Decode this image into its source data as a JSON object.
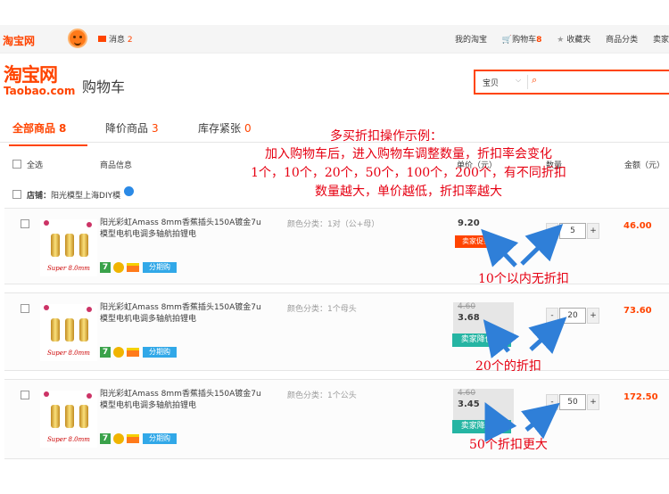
{
  "topbar": {
    "logo": "淘宝网",
    "messages_label": "消息",
    "messages_count": "2",
    "nav": {
      "my_taobao": "我的淘宝",
      "cart_label": "购物车",
      "cart_count": "8",
      "favorites": "收藏夹",
      "categories": "商品分类",
      "more": "卖家"
    }
  },
  "header": {
    "logo_cn": "淘宝网",
    "logo_en": "Taobao.com",
    "title": "购物车",
    "search_category": "宝贝"
  },
  "tabs": [
    {
      "label": "全部商品",
      "count": "8"
    },
    {
      "label": "降价商品",
      "count": "3"
    },
    {
      "label": "库存紧张",
      "count": "0"
    }
  ],
  "columns": {
    "select_all": "全选",
    "product_info": "商品信息",
    "price": "单价（元）",
    "qty": "数量",
    "amount": "金额（元）"
  },
  "shop": {
    "label": "店铺：",
    "name": "阳光模型上海DIY模"
  },
  "items": [
    {
      "title": "阳光彩虹Amass 8mm香蕉插头150A镀金7u模型电机电调多轴航拍锂电",
      "sku": "颜色分类：1对（公+母）",
      "old_price": "",
      "price": "9.20",
      "tag": "卖家促销",
      "qty": "5",
      "amount": "46.00",
      "thumb_brand": "Super 8.0mm",
      "pay_badge": "分期购",
      "badge_7": "7"
    },
    {
      "title": "阳光彩虹Amass 8mm香蕉插头150A镀金7u模型电机电调多轴航拍锂电",
      "sku": "颜色分类：1个母头",
      "old_price": "4.60",
      "price": "3.68",
      "tag": "卖家降价 ⌄",
      "qty": "20",
      "amount": "73.60",
      "thumb_brand": "Super 8.0mm",
      "pay_badge": "分期购",
      "badge_7": "7"
    },
    {
      "title": "阳光彩虹Amass 8mm香蕉插头150A镀金7u模型电机电调多轴航拍锂电",
      "sku": "颜色分类：1个公头",
      "old_price": "4.60",
      "price": "3.45",
      "tag": "卖家降价 ⌄",
      "qty": "50",
      "amount": "172.50",
      "thumb_brand": "Super 8.0mm",
      "pay_badge": "分期购",
      "badge_7": "7"
    }
  ],
  "annotations": {
    "title": "多买折扣操作示例：",
    "line1": "加入购物车后，进入购物车调整数量，折扣率会变化",
    "line2": "1个，10个，20个，50个，100个，200个，有不同折扣",
    "line3": "数量越大，单价越低，折扣率越大",
    "note1": "10个以内无折扣",
    "note2": "20个的折扣",
    "note3": "50个折扣更大"
  },
  "colors": {
    "accent": "#ff4400",
    "annotation": "#e60012",
    "drop_tag": "#25b5a3",
    "arrow": "#2f7fd8"
  }
}
